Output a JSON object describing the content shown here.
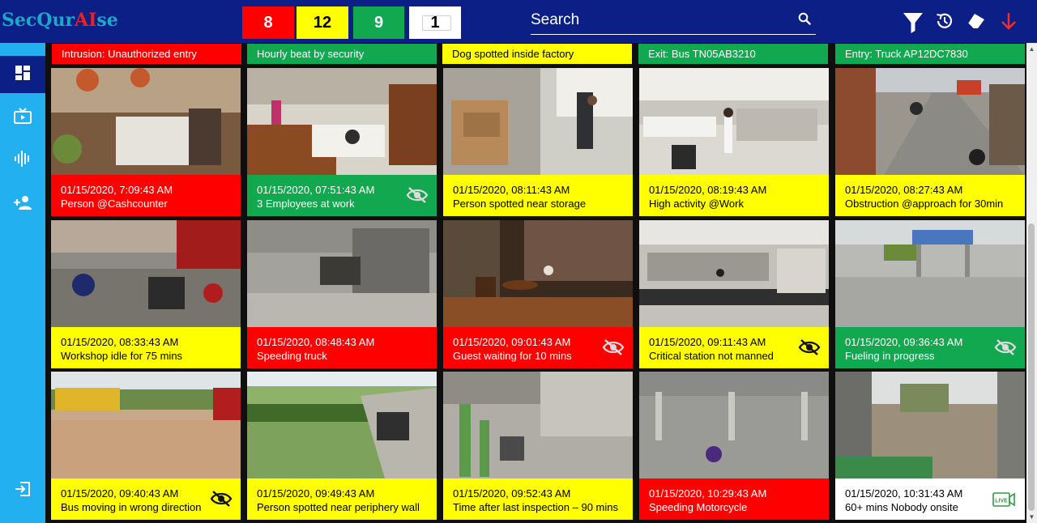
{
  "brand": {
    "part1": "SecQur",
    "part2": "AI",
    "part3": "se"
  },
  "counters": {
    "red": "8",
    "yellow": "12",
    "green": "9",
    "offline": "1"
  },
  "search": {
    "label": "Search"
  },
  "top_icons": [
    "filter-icon",
    "history-icon",
    "eraser-icon",
    "arrow-down-icon"
  ],
  "sidebar": {
    "items": [
      "dashboard-icon",
      "live-tv-icon",
      "audio-wave-icon",
      "add-user-icon"
    ],
    "bottom": "logout-icon"
  },
  "colors": {
    "red": "#ff0000",
    "yellow": "#ffff00",
    "green": "#11a84f",
    "navy": "#0b1f86",
    "sky": "#23b0f0"
  },
  "strips": [
    {
      "text": "Intrusion: Unauthorized entry",
      "status": "red"
    },
    {
      "text": "Hourly beat by security",
      "status": "green"
    },
    {
      "text": "Dog spotted inside factory",
      "status": "yellow"
    },
    {
      "text": "Exit: Bus TN05AB3210",
      "status": "green"
    },
    {
      "text": "Entry: Truck AP12DC7830",
      "status": "green"
    }
  ],
  "tiles": [
    {
      "ts": "01/15/2020,  7:09:43  AM",
      "desc": "Person @Cashcounter",
      "status": "red",
      "icon": ""
    },
    {
      "ts": "01/15/2020,  07:51:43  AM",
      "desc": "3 Employees  at work",
      "status": "green",
      "icon": "eye-off-icon"
    },
    {
      "ts": "01/15/2020,  08:11:43  AM",
      "desc": "Person spotted near storage",
      "status": "yellow",
      "icon": ""
    },
    {
      "ts": "01/15/2020,  08:19:43  AM",
      "desc": "High activity @Work",
      "status": "yellow",
      "icon": ""
    },
    {
      "ts": "01/15/2020,  08:27:43  AM",
      "desc": "Obstruction  @approach for 30min",
      "status": "yellow",
      "icon": ""
    },
    {
      "ts": "01/15/2020,  08:33:43  AM",
      "desc": "Workshop  idle for 75 mins",
      "status": "yellow",
      "icon": ""
    },
    {
      "ts": "01/15/2020,  08:48:43  AM",
      "desc": "Speeding truck",
      "status": "red",
      "icon": ""
    },
    {
      "ts": "01/15/2020,  09:01:43  AM",
      "desc": "Guest waiting for 10 mins",
      "status": "red",
      "icon": "eye-off-icon"
    },
    {
      "ts": "01/15/2020,  09:11:43  AM",
      "desc": "Critical station not manned",
      "status": "yellow",
      "icon": "eye-off-icon"
    },
    {
      "ts": "01/15/2020,  09:36:43  AM",
      "desc": "Fueling  in progress",
      "status": "green",
      "icon": "eye-off-icon"
    },
    {
      "ts": "01/15/2020,  09:40:43  AM",
      "desc": "Bus moving  in wrong direction",
      "status": "yellow",
      "icon": "eye-off-icon"
    },
    {
      "ts": "01/15/2020,  09:49:43  AM",
      "desc": "Person spotted near periphery  wall",
      "status": "yellow",
      "icon": ""
    },
    {
      "ts": "01/15/2020,  09:52:43  AM",
      "desc": "Time after last inspection – 90 mins",
      "status": "yellow",
      "icon": ""
    },
    {
      "ts": "01/15/2020,  10:29:43  AM",
      "desc": "Speeding Motorcycle",
      "status": "red",
      "icon": ""
    },
    {
      "ts": "01/15/2020,  10:31:43  AM",
      "desc": "60+ mins  Nobody onsite",
      "status": "white",
      "icon": "live-camera-icon",
      "icon_text": "LIVE"
    }
  ]
}
